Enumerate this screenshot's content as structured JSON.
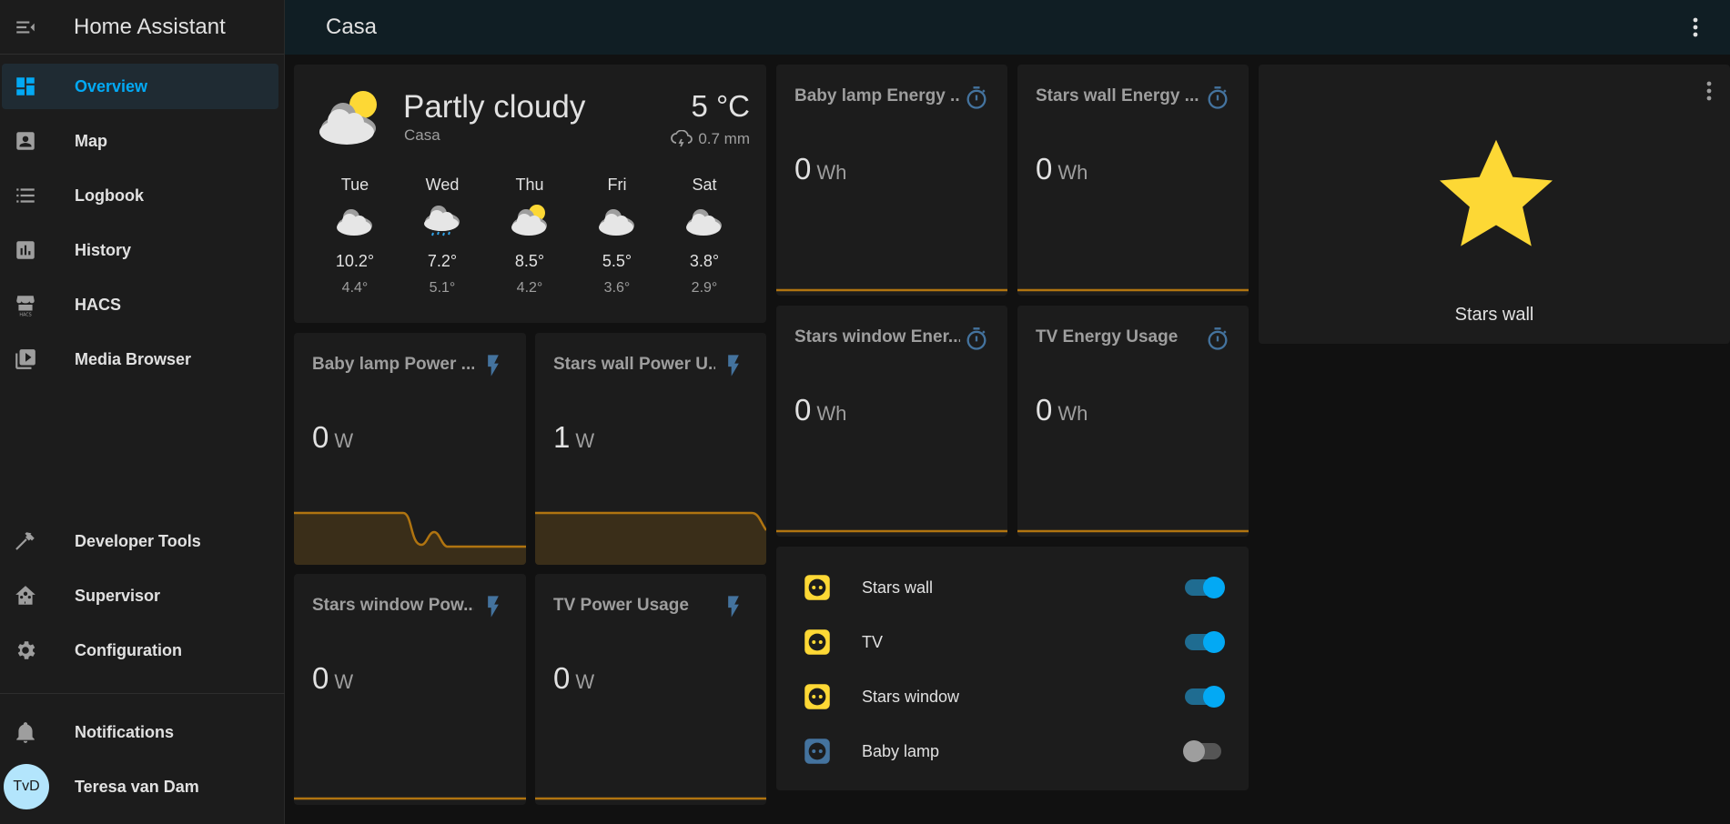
{
  "app": {
    "title": "Home Assistant"
  },
  "topbar": {
    "title": "Casa"
  },
  "sidebar": {
    "items": [
      {
        "label": "Overview",
        "icon": "view-dashboard-icon",
        "active": true
      },
      {
        "label": "Map",
        "icon": "account-box-icon"
      },
      {
        "label": "Logbook",
        "icon": "format-list-bulleted-icon"
      },
      {
        "label": "History",
        "icon": "chart-box-icon"
      },
      {
        "label": "HACS",
        "icon": "hacs-store-icon"
      },
      {
        "label": "Media Browser",
        "icon": "play-box-multiple-icon"
      }
    ],
    "bottom_items": [
      {
        "label": "Developer Tools",
        "icon": "hammer-icon"
      },
      {
        "label": "Supervisor",
        "icon": "home-assistant-icon"
      },
      {
        "label": "Configuration",
        "icon": "cog-icon"
      }
    ],
    "notifications_label": "Notifications",
    "user": {
      "name": "Teresa van Dam",
      "initials": "TvD"
    }
  },
  "weather": {
    "condition": "Partly cloudy",
    "location": "Casa",
    "temperature": "5 °C",
    "precipitation": "0.7 mm",
    "forecast": [
      {
        "day": "Tue",
        "high": "10.2°",
        "low": "4.4°",
        "icon": "cloudy-icon"
      },
      {
        "day": "Wed",
        "high": "7.2°",
        "low": "5.1°",
        "icon": "rainy-icon"
      },
      {
        "day": "Thu",
        "high": "8.5°",
        "low": "4.2°",
        "icon": "partly-cloudy-icon"
      },
      {
        "day": "Fri",
        "high": "5.5°",
        "low": "3.6°",
        "icon": "cloudy-icon"
      },
      {
        "day": "Sat",
        "high": "3.8°",
        "low": "2.9°",
        "icon": "cloudy-icon"
      }
    ]
  },
  "sensors": {
    "baby_power": {
      "title": "Baby lamp Power ...",
      "value": "0",
      "unit": "W",
      "icon": "flash-icon"
    },
    "stars_wall_power": {
      "title": "Stars wall Power U...",
      "value": "1",
      "unit": "W",
      "icon": "flash-icon"
    },
    "stars_window_power": {
      "title": "Stars window Pow...",
      "value": "0",
      "unit": "W",
      "icon": "flash-icon"
    },
    "tv_power": {
      "title": "TV Power Usage",
      "value": "0",
      "unit": "W",
      "icon": "flash-icon"
    },
    "baby_energy": {
      "title": "Baby lamp Energy ...",
      "value": "0",
      "unit": "Wh",
      "icon": "timer-icon"
    },
    "stars_wall_energy": {
      "title": "Stars wall Energy ...",
      "value": "0",
      "unit": "Wh",
      "icon": "timer-icon"
    },
    "stars_window_energy": {
      "title": "Stars window Ener...",
      "value": "0",
      "unit": "Wh",
      "icon": "timer-icon"
    },
    "tv_energy": {
      "title": "TV Energy Usage",
      "value": "0",
      "unit": "Wh",
      "icon": "timer-icon"
    }
  },
  "star_card": {
    "label": "Stars wall",
    "icon": "star-icon",
    "color": "#fdd835"
  },
  "entities": [
    {
      "name": "Stars wall",
      "state": "on",
      "icon": "power-socket-icon"
    },
    {
      "name": "TV",
      "state": "on",
      "icon": "power-socket-icon"
    },
    {
      "name": "Stars window",
      "state": "on",
      "icon": "power-socket-icon"
    },
    {
      "name": "Baby lamp",
      "state": "off",
      "icon": "power-socket-icon"
    }
  ],
  "colors": {
    "accent": "#03a9f4",
    "graph_line": "#b07410",
    "state_on": "#fdd835",
    "state_off": "#44739e"
  }
}
